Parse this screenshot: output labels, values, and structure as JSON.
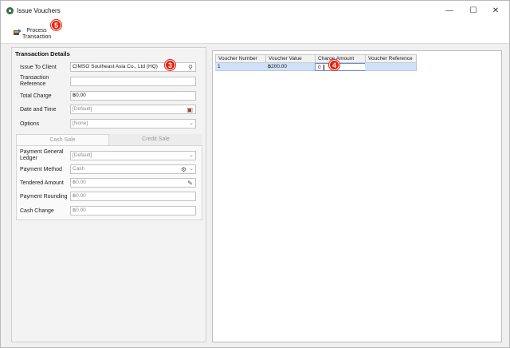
{
  "window": {
    "title": "Issue Vouchers",
    "controls": {
      "minimize": "—",
      "maximize": "☐",
      "close": "✕"
    }
  },
  "toolbar": {
    "process_label": "Process\nTransaction",
    "process_badge": "5"
  },
  "transaction_details": {
    "title": "Transaction Details",
    "issue_to_client": {
      "label": "Issue To Client",
      "value": "CIMSO Southeast Asia Co., Ltd (HQ)",
      "badge": "3"
    },
    "transaction_reference": {
      "label": "Transaction\nReference",
      "value": ""
    },
    "total_charge": {
      "label": "Total Charge",
      "value": "฿0.00"
    },
    "date_and_time": {
      "label": "Date and Time",
      "value": "[Default]"
    },
    "options": {
      "label": "Options",
      "value": "[None]"
    }
  },
  "sale_tabs": {
    "cash_sale": "Cash Sale",
    "credit_sale": "Credit Sale"
  },
  "cash_sale": {
    "payment_general_ledger": {
      "label": "Payment General\nLedger",
      "value": "[Default]"
    },
    "payment_method": {
      "label": "Payment Method",
      "value": "Cash"
    },
    "tendered_amount": {
      "label": "Tendered Amount",
      "value": "฿0.00"
    },
    "payment_rounding": {
      "label": "Payment Rounding",
      "value": "฿0.00"
    },
    "cash_change": {
      "label": "Cash Change",
      "value": "฿0.00"
    }
  },
  "voucher_grid": {
    "columns": [
      "Voucher Number",
      "Voucher Value",
      "Charge Amount",
      "Voucher Reference"
    ],
    "rows": [
      {
        "voucher_number": "1",
        "voucher_value": "฿200.00",
        "charge_amount": "0",
        "voucher_reference": ""
      }
    ],
    "charge_badge": "4"
  },
  "colors": {
    "badge": "#e8200c",
    "selected_row": "#cfe0f8",
    "panel_bg": "#f0f0f0"
  }
}
